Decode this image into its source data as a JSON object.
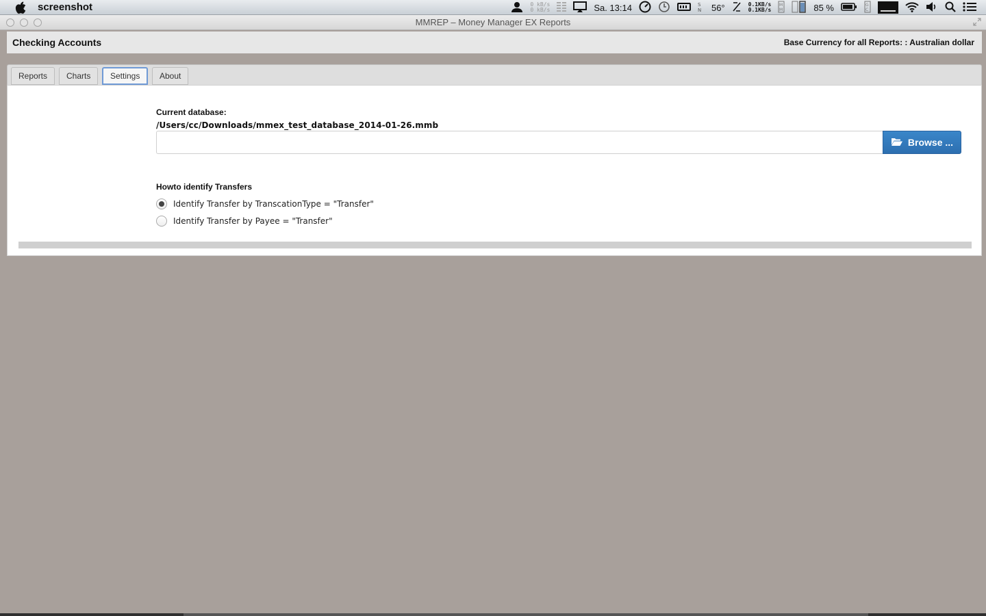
{
  "menubar": {
    "app_name": "screenshot",
    "net1_up": "0 kB/s",
    "net1_down": "0 kB/s",
    "clock": "Sa. 13:14",
    "temperature": "56°",
    "net2_up": "0.1KB/s",
    "net2_down": "0.1KB/s",
    "battery": "85 %"
  },
  "window": {
    "title": "MMREP – Money Manager EX Reports"
  },
  "header": {
    "title": "Checking Accounts",
    "base_currency": "Base Currency for all Reports: : Australian dollar"
  },
  "tabs": [
    {
      "label": "Reports",
      "active": false
    },
    {
      "label": "Charts",
      "active": false
    },
    {
      "label": "Settings",
      "active": true
    },
    {
      "label": "About",
      "active": false
    }
  ],
  "settings": {
    "db_label": "Current database:",
    "db_path": "/Users/cc/Downloads/mmex_test_database_2014-01-26.mmb",
    "db_input_value": "",
    "browse_label": "Browse ...",
    "transfers_label": "Howto identify Transfers",
    "radio_options": [
      {
        "label": "Identify Transfer by TranscationType = \"Transfer\"",
        "checked": true
      },
      {
        "label": "Identify Transfer by Payee = \"Transfer\"",
        "checked": false
      }
    ],
    "progress_percent": 0
  },
  "colors": {
    "accent": "#3a86c9",
    "background": "#a8a09b",
    "active_tab_border": "#6f9ad6"
  }
}
